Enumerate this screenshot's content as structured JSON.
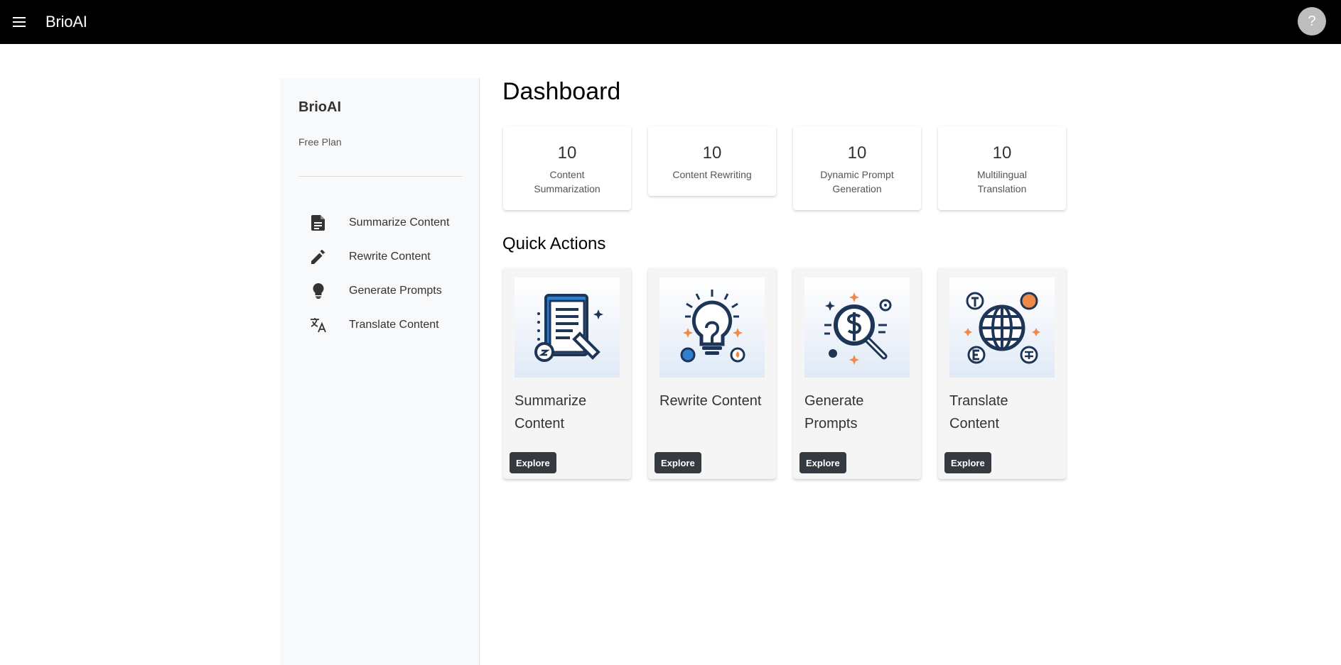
{
  "appbar": {
    "title": "BrioAI",
    "menu_icon": "menu-icon",
    "help_label": "?"
  },
  "sidebar": {
    "brand": "BrioAI",
    "plan": "Free Plan",
    "items": [
      {
        "label": "Summarize Content",
        "icon": "file-document-icon"
      },
      {
        "label": "Rewrite Content",
        "icon": "pencil-icon"
      },
      {
        "label": "Generate Prompts",
        "icon": "lightbulb-icon"
      },
      {
        "label": "Translate Content",
        "icon": "translate-icon"
      }
    ]
  },
  "main": {
    "title": "Dashboard",
    "stats": [
      {
        "value": "10",
        "label": "Content Summarization"
      },
      {
        "value": "10",
        "label": "Content Rewriting"
      },
      {
        "value": "10",
        "label": "Dynamic Prompt Generation"
      },
      {
        "value": "10",
        "label": "Multilingual Translation"
      }
    ],
    "quick_actions_title": "Quick Actions",
    "actions": [
      {
        "title": "Summarize Content",
        "button": "Explore",
        "image": "document-summary-illustration"
      },
      {
        "title": "Rewrite Content",
        "button": "Explore",
        "image": "lightbulb-illustration"
      },
      {
        "title": "Generate Prompts",
        "button": "Explore",
        "image": "magnifier-illustration"
      },
      {
        "title": "Translate Content",
        "button": "Explore",
        "image": "globe-illustration"
      }
    ]
  },
  "colors": {
    "appbar_bg": "#000000",
    "sidebar_bg": "#f8f9fa",
    "button_bg": "#343a40",
    "illustration_navy": "#1d3557",
    "illustration_blue": "#2f7fd1",
    "illustration_orange": "#f08a4b"
  }
}
